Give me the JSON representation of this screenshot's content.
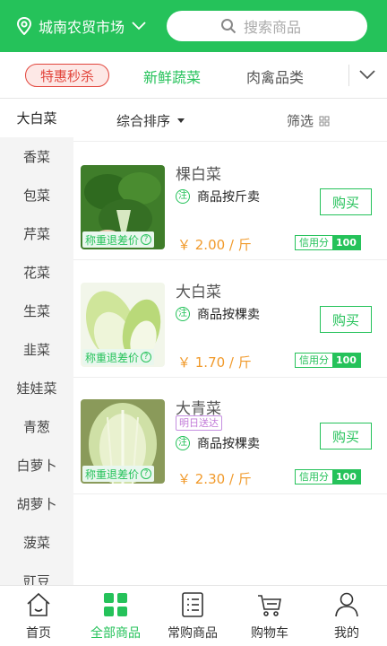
{
  "header": {
    "location": "城南农贸市场",
    "search_placeholder": "搜索商品"
  },
  "category_tabs": {
    "flash_sale": "特惠秒杀",
    "tabs": [
      "新鲜蔬菜",
      "肉禽品类"
    ]
  },
  "sidebar": {
    "items": [
      "大白菜",
      "香菜",
      "包菜",
      "芹菜",
      "花菜",
      "生菜",
      "韭菜",
      "娃娃菜",
      "青葱",
      "白萝卜",
      "胡萝卜",
      "菠菜",
      "豇豆"
    ]
  },
  "sortbar": {
    "sort_label": "综合排序",
    "filter_label": "筛选"
  },
  "products": [
    {
      "name": "棵白菜",
      "note_icon": "注",
      "note": "商品按斤卖",
      "buy_label": "购买",
      "price": "￥ 2.00 / 斤",
      "credit_label": "信用分",
      "credit_value": "100",
      "refund_label": "称重退差价"
    },
    {
      "name": "大白菜",
      "note_icon": "注",
      "note": "商品按棵卖",
      "buy_label": "购买",
      "price": "￥ 1.70 / 斤",
      "credit_label": "信用分",
      "credit_value": "100",
      "refund_label": "称重退差价"
    },
    {
      "name": "大青菜",
      "tag": "明日送达",
      "note_icon": "注",
      "note": "商品按棵卖",
      "buy_label": "购买",
      "price": "￥ 2.30 / 斤",
      "credit_label": "信用分",
      "credit_value": "100",
      "refund_label": "称重退差价"
    }
  ],
  "bottom_nav": {
    "items": [
      "首页",
      "全部商品",
      "常购商品",
      "购物车",
      "我的"
    ],
    "active": "全部商品"
  },
  "colors": {
    "brand_green": "#25c25a",
    "price_orange": "#f19a2b",
    "flash_red": "#e2453c",
    "tag_purple": "#c27ad8"
  },
  "icons": [
    "location-pin-icon",
    "chevron-down-icon",
    "search-icon",
    "filter-grid-icon",
    "home-icon",
    "all-products-icon",
    "frequent-list-icon",
    "cart-icon",
    "profile-icon"
  ]
}
